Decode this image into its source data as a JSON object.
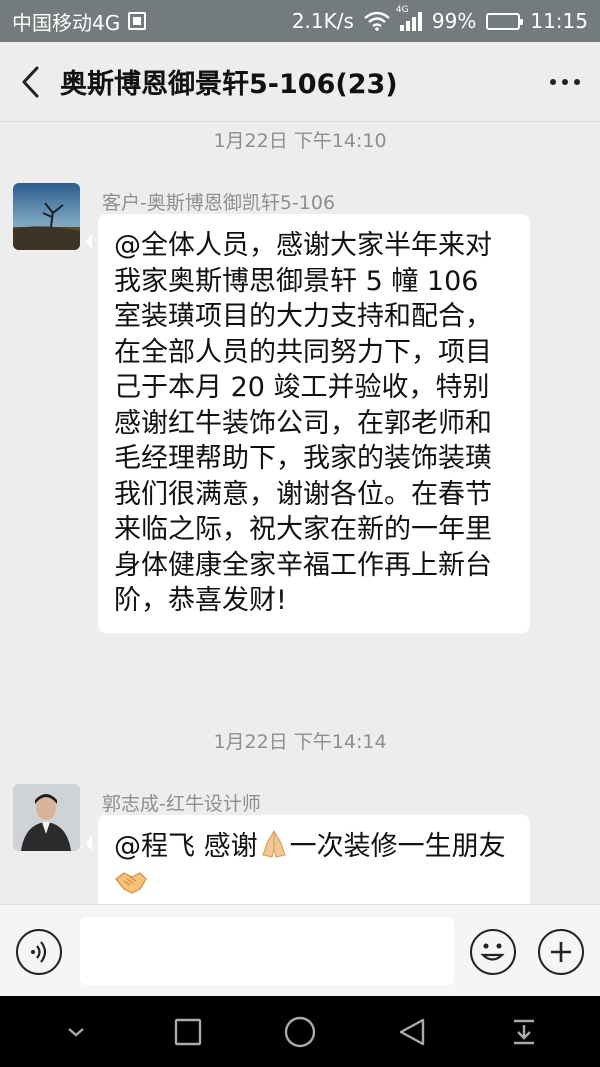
{
  "status_bar": {
    "carrier": "中国移动4G",
    "net_speed": "2.1K/s",
    "network_tag": "4G",
    "battery_percent": "99%",
    "battery_level": 0.99,
    "time": "11:15"
  },
  "header": {
    "title": "奥斯博恩御景轩5-106(23)"
  },
  "chat": {
    "messages": [
      {
        "timestamp": "1月22日 下午14:10",
        "sender": "客户-奥斯博恩御凯轩5-106",
        "text": "@全体人员，感谢大家半年来对我家奥斯博思御景轩 5 幢 106 室装璜项目的大力支持和配合，在全部人员的共同努力下，项目己于本月 20 竣工并验收，特别感谢红牛装饰公司，在郭老师和毛经理帮助下，我家的装饰装璜我们很满意，谢谢各位。在春节来临之际，祝大家在新的一年里身体健康全家辛福工作再上新台阶，恭喜发财!"
      },
      {
        "timestamp": "1月22日 下午14:14",
        "sender": "郭志成-红牛设计师",
        "text_part1": "@程飞  感谢",
        "emoji1": "folded-hands-emoji",
        "text_part2": "一次装修一生朋友",
        "emoji2": "handshake-emoji"
      }
    ]
  },
  "input": {
    "placeholder": ""
  },
  "colors": {
    "status_bar_bg": "#747b7d",
    "chat_bg": "#ededed",
    "bubble_bg": "#ffffff",
    "nav_bg": "#000000"
  },
  "icons": [
    "back-arrow-icon",
    "more-dots-icon",
    "voice-icon",
    "emoji-icon",
    "plus-icon",
    "nav-collapse-icon",
    "nav-recent-icon",
    "nav-home-icon",
    "nav-back-icon",
    "nav-notification-icon"
  ]
}
